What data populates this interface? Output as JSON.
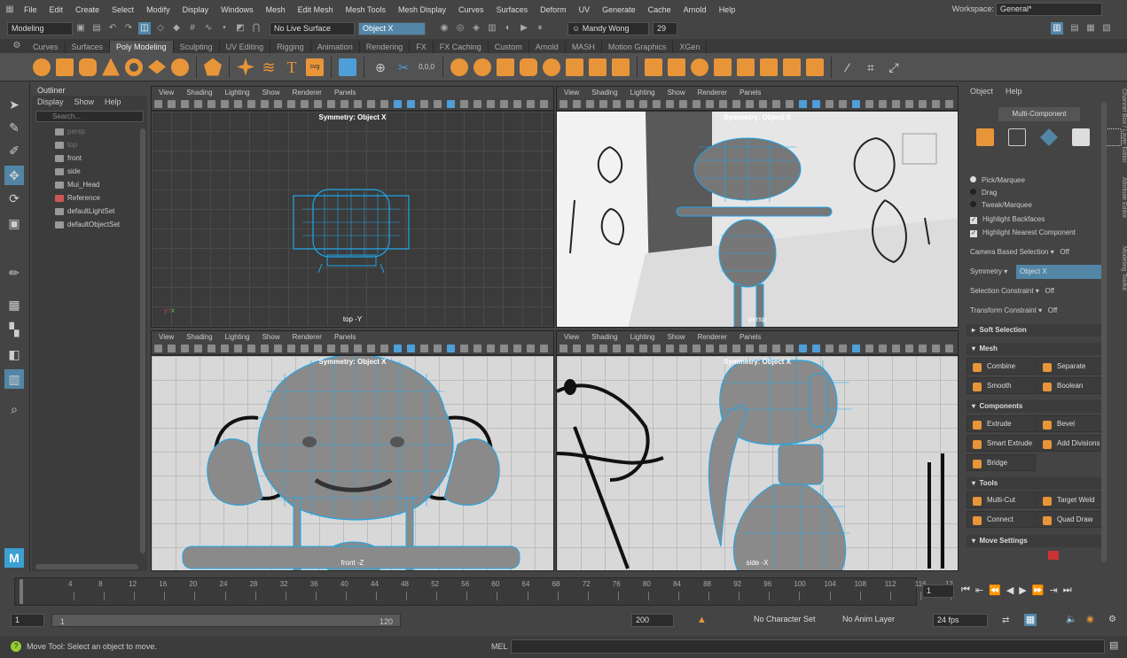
{
  "menu": [
    "File",
    "Edit",
    "Create",
    "Select",
    "Modify",
    "Display",
    "Windows",
    "Mesh",
    "Edit Mesh",
    "Mesh Tools",
    "Mesh Display",
    "Curves",
    "Surfaces",
    "Deform",
    "UV",
    "Generate",
    "Cache",
    "Arnold",
    "Help"
  ],
  "workspace": {
    "label": "Workspace:",
    "value": "General*"
  },
  "status": {
    "mode": "Modeling",
    "live_surface": "No Live Surface",
    "symmetry": "Object X",
    "user": "Mandy Wong",
    "notifications": "29"
  },
  "shelf_tabs": [
    "Curves",
    "Surfaces",
    "Poly Modeling",
    "Sculpting",
    "UV Editing",
    "Rigging",
    "Animation",
    "Rendering",
    "FX",
    "FX Caching",
    "Custom",
    "Arnold",
    "MASH",
    "Motion Graphics",
    "XGen"
  ],
  "active_shelf_tab": "Poly Modeling",
  "outliner": {
    "tab": "Outliner",
    "menu": [
      "Display",
      "Show",
      "Help"
    ],
    "search_placeholder": "Search...",
    "items": [
      {
        "label": "persp",
        "dim": true
      },
      {
        "label": "top",
        "dim": true
      },
      {
        "label": "front",
        "dim": false
      },
      {
        "label": "side",
        "dim": false
      },
      {
        "label": "Mui_Head",
        "dim": false
      },
      {
        "label": "Reference",
        "dim": false
      },
      {
        "label": "defaultLightSet",
        "dim": false
      },
      {
        "label": "defaultObjectSet",
        "dim": false
      }
    ]
  },
  "viewport_menu": [
    "View",
    "Shading",
    "Lighting",
    "Show",
    "Renderer",
    "Panels"
  ],
  "viewports": [
    {
      "camera": "top -Y",
      "symmetry": "Symmetry: Object X"
    },
    {
      "camera": "persp",
      "symmetry": "Symmetry: Object X"
    },
    {
      "camera": "front -Z",
      "symmetry": "Symmetry: Object X"
    },
    {
      "camera": "side -X",
      "symmetry": "Symmetry: Object X"
    }
  ],
  "modeling_toolkit": {
    "menu": [
      "Object",
      "Help"
    ],
    "mode_button": "Multi-Component",
    "pick_options": [
      "Pick/Marquee",
      "Drag",
      "Tweak/Marquee"
    ],
    "checks": [
      "Highlight Backfaces",
      "Highlight Nearest Component"
    ],
    "camera_based_selection": {
      "label": "Camera Based Selection",
      "value": "Off"
    },
    "symmetry": {
      "label": "Symmetry",
      "value": "Object X"
    },
    "selection_constraint": {
      "label": "Selection Constraint",
      "value": "Off"
    },
    "transform_constraint": {
      "label": "Transform Constraint",
      "value": "Off"
    },
    "soft_selection": "Soft Selection",
    "mesh_section": "Mesh",
    "mesh_buttons": [
      "Combine",
      "Separate",
      "Smooth",
      "Boolean"
    ],
    "components_section": "Components",
    "component_buttons": [
      "Extrude",
      "Bevel",
      "Smart Extrude",
      "Add Divisions",
      "Bridge"
    ],
    "tools_section": "Tools",
    "tool_buttons": [
      "Multi-Cut",
      "Target Weld",
      "Connect",
      "Quad Draw"
    ],
    "move_settings": "Move Settings"
  },
  "side_tabs": [
    "Channel Box / Layer Editor",
    "Attribute Editor",
    "Modeling Toolkit"
  ],
  "timeline": {
    "ticks": [
      "4",
      "8",
      "12",
      "16",
      "20",
      "24",
      "28",
      "32",
      "36",
      "40",
      "44",
      "48",
      "52",
      "56",
      "60",
      "64",
      "68",
      "72",
      "76",
      "80",
      "84",
      "88",
      "92",
      "96",
      "100",
      "104",
      "108",
      "112",
      "116",
      "12"
    ],
    "current_frame": "1"
  },
  "range": {
    "start": "1",
    "inner_start": "1",
    "inner_end": "120",
    "end": "200",
    "character_set": "No Character Set",
    "anim_layer": "No Anim Layer",
    "fps": "24 fps"
  },
  "command": {
    "help": "Move Tool: Select an object to move.",
    "lang": "MEL"
  },
  "colors": {
    "accent": "#5285a6",
    "orange": "#e8953a",
    "wire": "#1ea6e8"
  }
}
